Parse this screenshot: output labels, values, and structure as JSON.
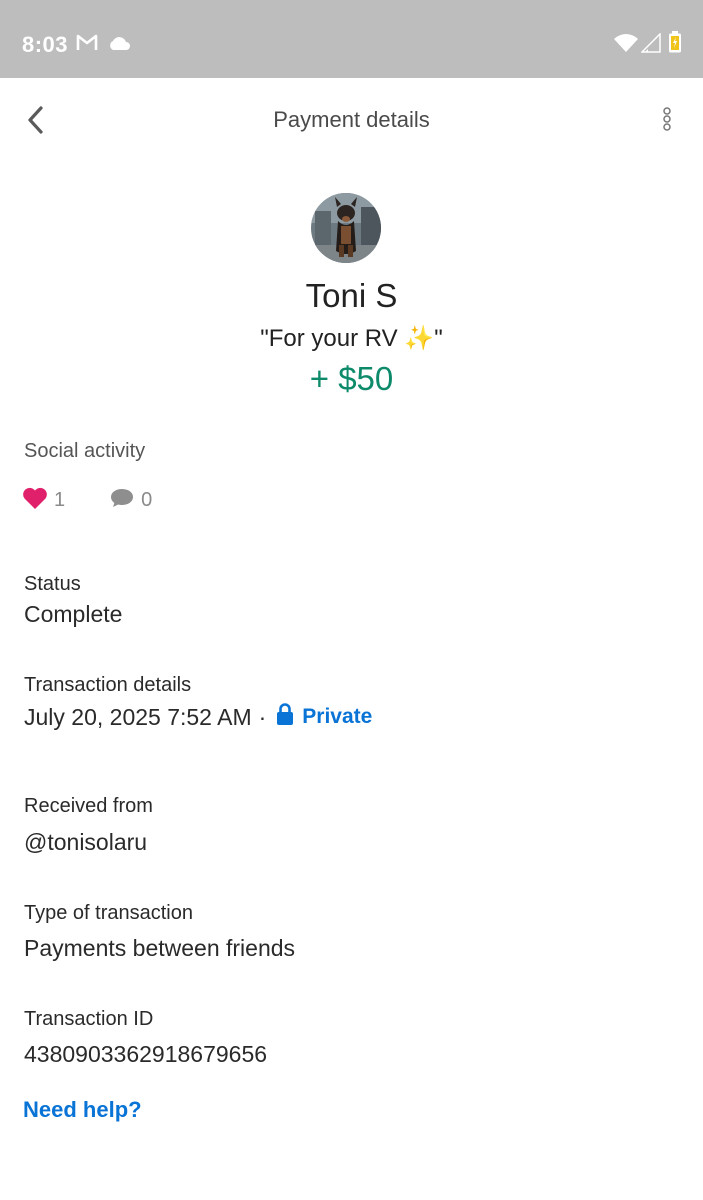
{
  "status_bar": {
    "time": "8:03",
    "left_icons": [
      "gmail-icon",
      "cloud-icon"
    ],
    "right_icons": [
      "wifi-icon",
      "signal-icon",
      "battery-icon"
    ]
  },
  "header": {
    "title": "Payment details",
    "back_icon": "chevron-left-icon",
    "menu_icon": "more-vertical-icon"
  },
  "payment": {
    "name": "Toni S",
    "note": "\"For your RV ✨\"",
    "amount": "+ $50",
    "amount_color": "#0d8a6a"
  },
  "social": {
    "label": "Social activity",
    "likes": "1",
    "comments": "0",
    "like_color": "#e0206b"
  },
  "status": {
    "label": "Status",
    "value": "Complete"
  },
  "transaction_details": {
    "label": "Transaction details",
    "datetime": "July 20, 2025 7:52 AM",
    "separator": "·",
    "privacy": "Private",
    "privacy_color": "#0a74d6"
  },
  "received_from": {
    "label": "Received from",
    "value": "@tonisolaru"
  },
  "type": {
    "label": "Type of transaction",
    "value": "Payments between friends"
  },
  "transaction_id": {
    "label": "Transaction ID",
    "value": "4380903362918679656"
  },
  "help": {
    "label": "Need help?"
  }
}
